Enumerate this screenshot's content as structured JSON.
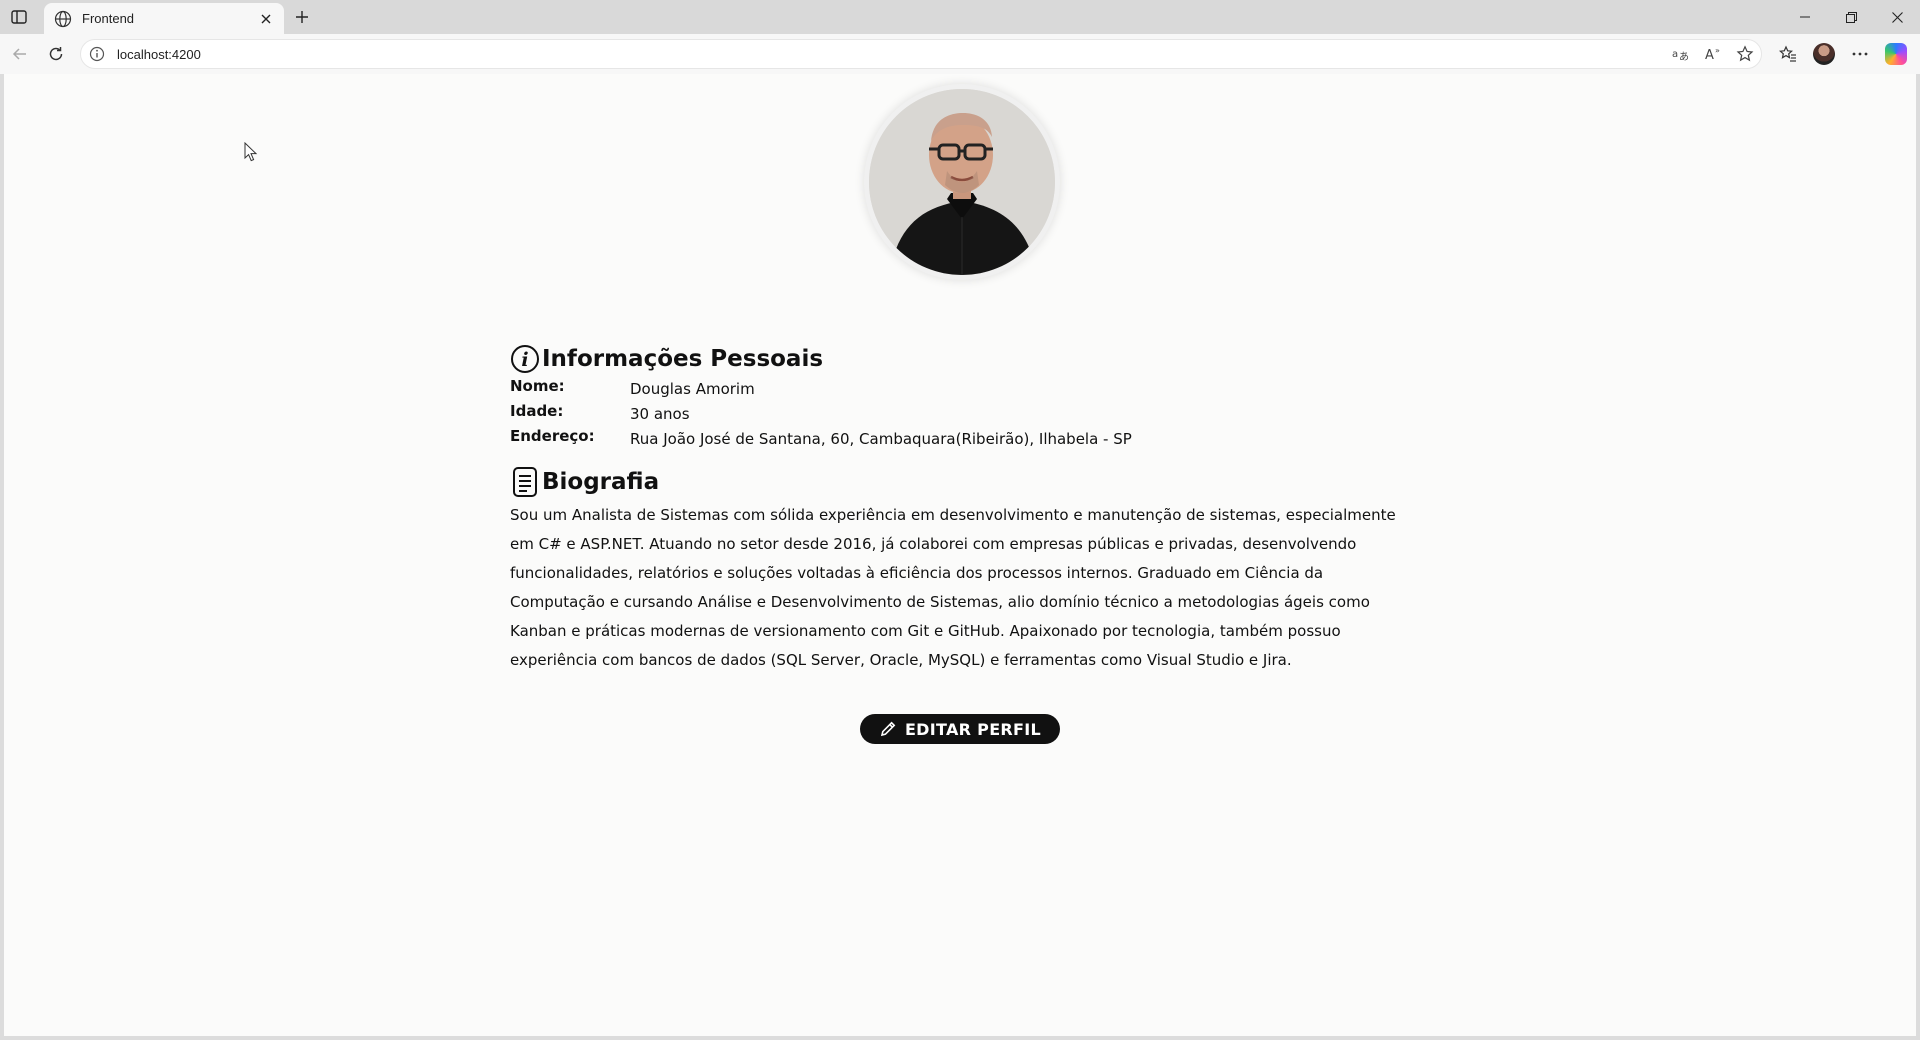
{
  "browser": {
    "tab_title": "Frontend",
    "url": "localhost:4200"
  },
  "profile": {
    "photo_alt": "Foto de perfil"
  },
  "personal_info": {
    "heading": "Informações Pessoais",
    "fields": [
      {
        "label": "Nome:",
        "value": "Douglas Amorim"
      },
      {
        "label": "Idade:",
        "value": "30 anos"
      },
      {
        "label": "Endereço:",
        "value": "Rua João José de Santana, 60, Cambaquara(Ribeirão), Ilhabela - SP"
      }
    ]
  },
  "biography": {
    "heading": "Biografia",
    "lines": [
      "Sou um Analista de Sistemas com sólida experiência em desenvolvimento e manutenção de sistemas, especialmente",
      "em C# e ASP.NET. Atuando no setor desde 2016, já colaborei com empresas públicas e privadas, desenvolvendo",
      "funcionalidades, relatórios e soluções voltadas à eficiência dos processos internos. Graduado em Ciência da",
      "Computação e cursando Análise e Desenvolvimento de Sistemas, alio domínio técnico a metodologias ágeis como",
      "Kanban e práticas modernas de versionamento com Git e GitHub. Apaixonado por tecnologia, também possuo",
      "experiência com bancos de dados (SQL Server, Oracle, MySQL) e ferramentas como Visual Studio e Jira."
    ]
  },
  "actions": {
    "edit_label": "EDITAR PERFIL"
  }
}
